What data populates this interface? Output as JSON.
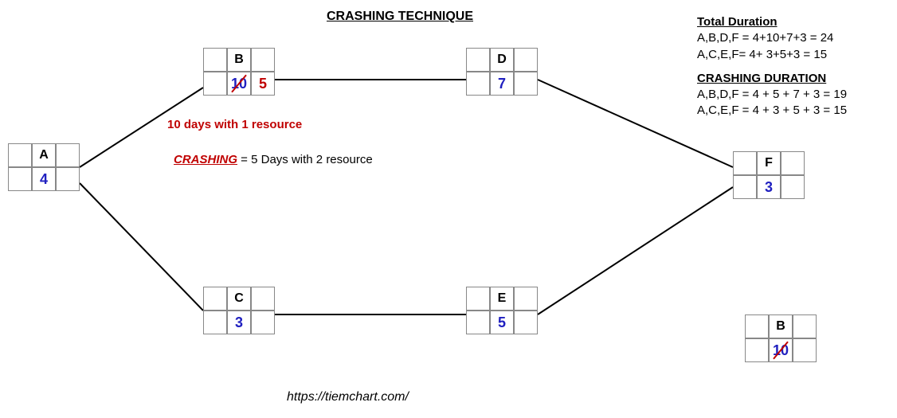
{
  "title": "CRASHING TECHNIQUE",
  "nodes": {
    "A": {
      "name": "A",
      "val": "4"
    },
    "B": {
      "name": "B",
      "val": "10",
      "crash": "5"
    },
    "C": {
      "name": "C",
      "val": "3"
    },
    "D": {
      "name": "D",
      "val": "7"
    },
    "E": {
      "name": "E",
      "val": "5"
    },
    "F": {
      "name": "F",
      "val": "3"
    },
    "Bsmall": {
      "name": "B",
      "val": "10"
    }
  },
  "notes": {
    "line1": "10 days with 1 resource",
    "crashing_label": "CRASHING",
    "line2_rest": " = 5 Days with 2 resource"
  },
  "info": {
    "total_hd": "Total Duration",
    "total_l1": "A,B,D,F = 4+10+7+3 = 24",
    "total_l2": "A,C,E,F=  4+  3+5+3 = 15",
    "crash_hd": "CRASHING DURATION",
    "crash_l1": "A,B,D,F = 4 + 5 + 7 + 3 = 19",
    "crash_l2": "A,C,E,F = 4 + 3 + 5 + 3 = 15"
  },
  "footer": "https://tiemchart.com/",
  "chart_data": {
    "type": "network-diagram",
    "title": "CRASHING TECHNIQUE",
    "activities": [
      {
        "id": "A",
        "normal_duration": 4
      },
      {
        "id": "B",
        "normal_duration": 10,
        "crashed_duration": 5,
        "note": "10 days with 1 resource; 5 days with 2 resources"
      },
      {
        "id": "C",
        "normal_duration": 3
      },
      {
        "id": "D",
        "normal_duration": 7
      },
      {
        "id": "E",
        "normal_duration": 5
      },
      {
        "id": "F",
        "normal_duration": 3
      }
    ],
    "edges": [
      [
        "A",
        "B"
      ],
      [
        "A",
        "C"
      ],
      [
        "B",
        "D"
      ],
      [
        "C",
        "E"
      ],
      [
        "D",
        "F"
      ],
      [
        "E",
        "F"
      ]
    ],
    "paths": {
      "normal": [
        {
          "sequence": [
            "A",
            "B",
            "D",
            "F"
          ],
          "expr": "4+10+7+3",
          "total": 24
        },
        {
          "sequence": [
            "A",
            "C",
            "E",
            "F"
          ],
          "expr": "4+3+5+3",
          "total": 15
        }
      ],
      "crashed": [
        {
          "sequence": [
            "A",
            "B",
            "D",
            "F"
          ],
          "expr": "4+5+7+3",
          "total": 19
        },
        {
          "sequence": [
            "A",
            "C",
            "E",
            "F"
          ],
          "expr": "4+3+5+3",
          "total": 15
        }
      ]
    }
  }
}
